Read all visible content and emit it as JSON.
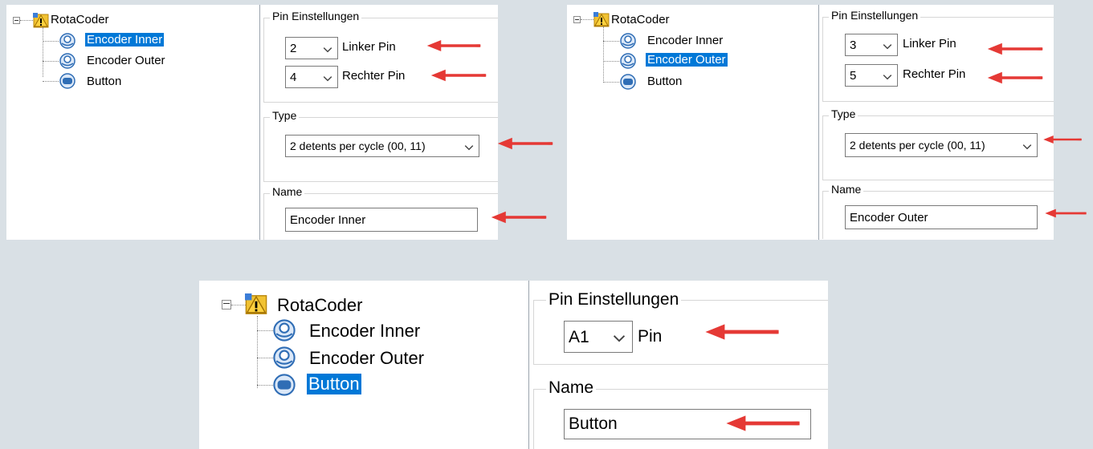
{
  "colors": {
    "background": "#d9e0e5",
    "selection": "#0078d7",
    "arrow": "#e53935"
  },
  "screens": [
    {
      "tree": {
        "root": "RotaCoder",
        "items": [
          {
            "label": "Encoder Inner",
            "icon": "encoder-icon",
            "selected": true
          },
          {
            "label": "Encoder Outer",
            "icon": "encoder-icon",
            "selected": false
          },
          {
            "label": "Button",
            "icon": "button-icon",
            "selected": false
          }
        ]
      },
      "pin_group": {
        "title": "Pin Einstellungen",
        "pins": [
          {
            "value": "2",
            "label": "Linker Pin"
          },
          {
            "value": "4",
            "label": "Rechter Pin"
          }
        ]
      },
      "type_group": {
        "title": "Type",
        "value": "2 detents per cycle (00, 11)"
      },
      "name_group": {
        "title": "Name",
        "value": "Encoder Inner"
      }
    },
    {
      "tree": {
        "root": "RotaCoder",
        "items": [
          {
            "label": "Encoder Inner",
            "icon": "encoder-icon",
            "selected": false
          },
          {
            "label": "Encoder Outer",
            "icon": "encoder-icon",
            "selected": true
          },
          {
            "label": "Button",
            "icon": "button-icon",
            "selected": false
          }
        ]
      },
      "pin_group": {
        "title": "Pin Einstellungen",
        "pins": [
          {
            "value": "3",
            "label": "Linker Pin"
          },
          {
            "value": "5",
            "label": "Rechter Pin"
          }
        ]
      },
      "type_group": {
        "title": "Type",
        "value": "2 detents per cycle (00, 11)"
      },
      "name_group": {
        "title": "Name",
        "value": "Encoder Outer"
      }
    },
    {
      "tree": {
        "root": "RotaCoder",
        "items": [
          {
            "label": "Encoder Inner",
            "icon": "encoder-icon",
            "selected": false
          },
          {
            "label": "Encoder Outer",
            "icon": "encoder-icon",
            "selected": false
          },
          {
            "label": "Button",
            "icon": "button-icon",
            "selected": true
          }
        ]
      },
      "pin_group": {
        "title": "Pin Einstellungen",
        "pins": [
          {
            "value": "A1",
            "label": "Pin"
          }
        ]
      },
      "name_group": {
        "title": "Name",
        "value": "Button"
      }
    }
  ]
}
